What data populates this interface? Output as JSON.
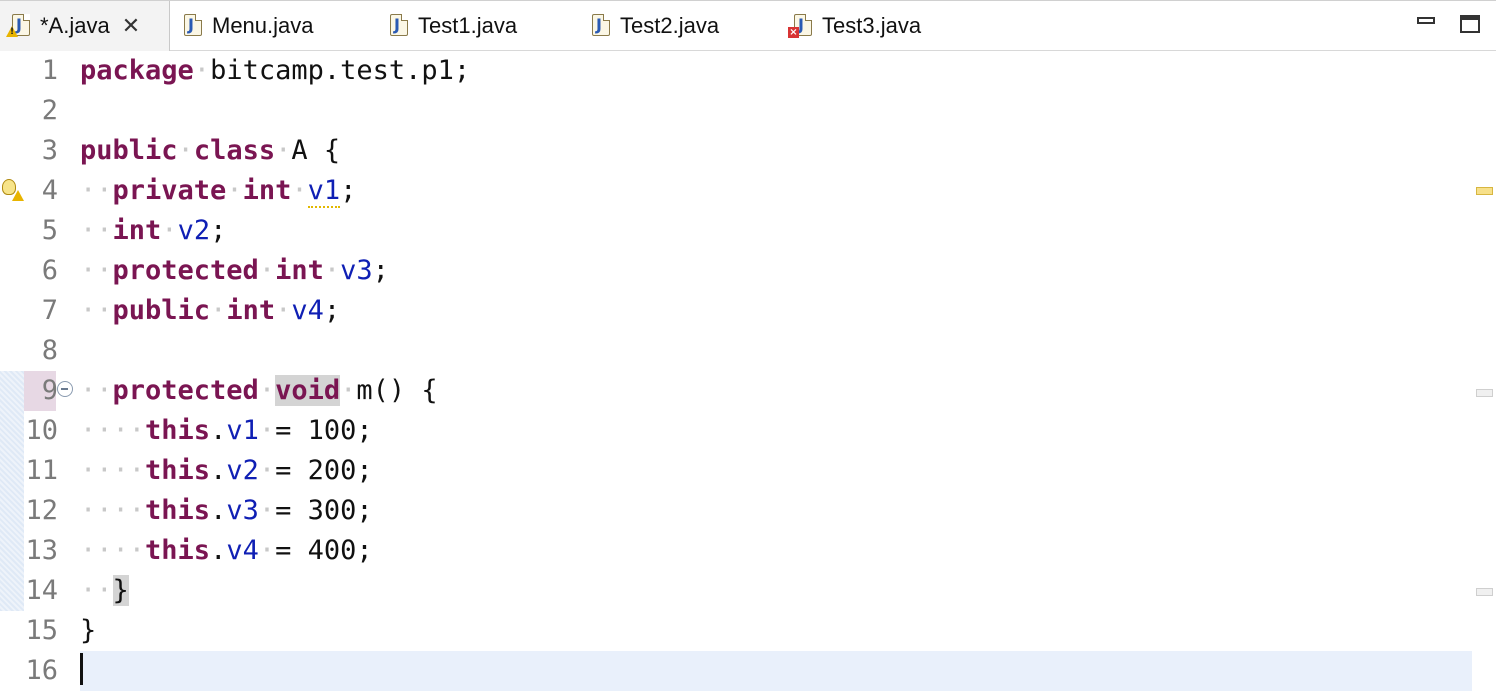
{
  "tabs": [
    {
      "label": "*A.java",
      "active": true,
      "status": "warning",
      "closable": true
    },
    {
      "label": "Menu.java",
      "active": false,
      "status": "none"
    },
    {
      "label": "Test1.java",
      "active": false,
      "status": "none"
    },
    {
      "label": "Test2.java",
      "active": false,
      "status": "none"
    },
    {
      "label": "Test3.java",
      "active": false,
      "status": "error"
    }
  ],
  "tab_close_glyph": "✕",
  "line_numbers": [
    "1",
    "2",
    "3",
    "4",
    "5",
    "6",
    "7",
    "8",
    "9",
    "10",
    "11",
    "12",
    "13",
    "14",
    "15",
    "16"
  ],
  "code": {
    "l1": {
      "kw": "package",
      "rest": "bitcamp.test.p1;"
    },
    "l3": {
      "kw1": "public",
      "kw2": "class",
      "rest": "A {"
    },
    "l4": {
      "kw1": "private",
      "kw2": "int",
      "field": "v1",
      "end": ";"
    },
    "l5": {
      "kw1": "int",
      "field": "v2",
      "end": ";"
    },
    "l6": {
      "kw1": "protected",
      "kw2": "int",
      "field": "v3",
      "end": ";"
    },
    "l7": {
      "kw1": "public",
      "kw2": "int",
      "field": "v4",
      "end": ";"
    },
    "l9": {
      "kw1": "protected",
      "kw2": "void",
      "rest": "m() {"
    },
    "l10": {
      "kw": "this",
      "field": "v1",
      "rest": "= 100;"
    },
    "l11": {
      "kw": "this",
      "field": "v2",
      "rest": "= 200;"
    },
    "l12": {
      "kw": "this",
      "field": "v3",
      "rest": "= 300;"
    },
    "l13": {
      "kw": "this",
      "field": "v4",
      "rest": "= 400;"
    },
    "l14": {
      "brace": "}"
    },
    "l15": {
      "brace": "}"
    }
  },
  "colors": {
    "keyword": "#7a1552",
    "field": "#0f1fb4",
    "whitespace_marker": "#c8c8c8",
    "current_line": "#e9f0fb"
  },
  "icons": {
    "tab_file": "java-file-icon",
    "warning": "warning-icon",
    "error": "error-icon",
    "quickfix": "lightbulb-warning-icon",
    "fold": "fold-collapse-icon"
  }
}
